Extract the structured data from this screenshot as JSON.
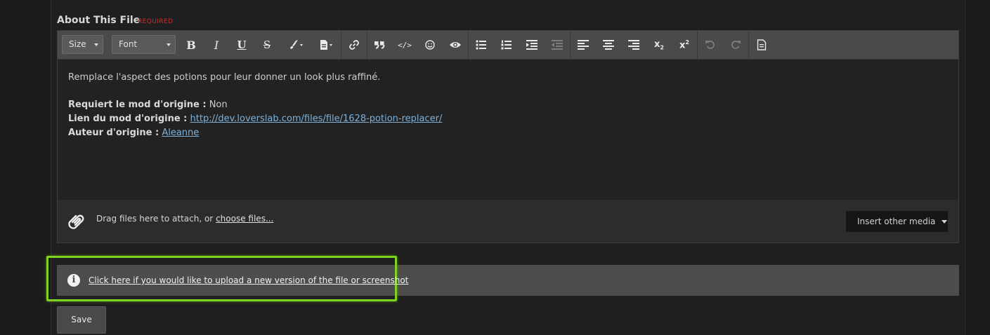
{
  "field": {
    "label": "About This File",
    "required": "REQUIRED"
  },
  "toolbar": {
    "size_label": "Size",
    "font_label": "Font",
    "buttons": [
      {
        "name": "bold-icon",
        "glyph": "B"
      },
      {
        "name": "italic-icon",
        "glyph": "I"
      },
      {
        "name": "underline-icon",
        "glyph": "U"
      },
      {
        "name": "strikethrough-icon",
        "glyph": "S"
      },
      {
        "name": "text-color-icon",
        "glyph": "brush"
      },
      {
        "name": "paste-icon",
        "glyph": "doc"
      },
      {
        "name": "link-icon",
        "glyph": "link"
      },
      {
        "name": "quote-icon",
        "glyph": "❞"
      },
      {
        "name": "code-icon",
        "glyph": "</>"
      },
      {
        "name": "emoji-icon",
        "glyph": "☺"
      },
      {
        "name": "spoiler-icon",
        "glyph": "eye"
      },
      {
        "name": "bulleted-list-icon",
        "glyph": "ul"
      },
      {
        "name": "numbered-list-icon",
        "glyph": "ol"
      },
      {
        "name": "indent-icon",
        "glyph": "indent"
      },
      {
        "name": "outdent-icon",
        "glyph": "outdent"
      },
      {
        "name": "align-left-icon",
        "glyph": "left"
      },
      {
        "name": "align-center-icon",
        "glyph": "center"
      },
      {
        "name": "align-right-icon",
        "glyph": "right"
      },
      {
        "name": "subscript-icon",
        "glyph": "x₂"
      },
      {
        "name": "superscript-icon",
        "glyph": "x²"
      },
      {
        "name": "undo-icon",
        "glyph": "↶"
      },
      {
        "name": "redo-icon",
        "glyph": "↷"
      },
      {
        "name": "source-icon",
        "glyph": "page"
      }
    ]
  },
  "content": {
    "intro": "Remplace l'aspect des potions pour leur donner un look plus raffiné.",
    "requires_label": "Requiert le mod d'origine :",
    "requires_value": "Non",
    "link_label": "Lien du mod d'origine :",
    "link_value": "http://dev.loverslab.com/files/file/1628-potion-replacer/",
    "author_label": "Auteur d'origine :",
    "author_value": "Aleanne"
  },
  "attachments": {
    "drag_text": "Drag files here to attach, or",
    "choose_link": "choose files...",
    "insert_media": "Insert other media"
  },
  "info": {
    "upload_link": "Click here if you would like to upload a new version of the file or screenshot"
  },
  "actions": {
    "save_label": "Save"
  },
  "colors": {
    "highlight": "#7ed320",
    "required": "#c8312f",
    "link": "#7eb1d9"
  }
}
